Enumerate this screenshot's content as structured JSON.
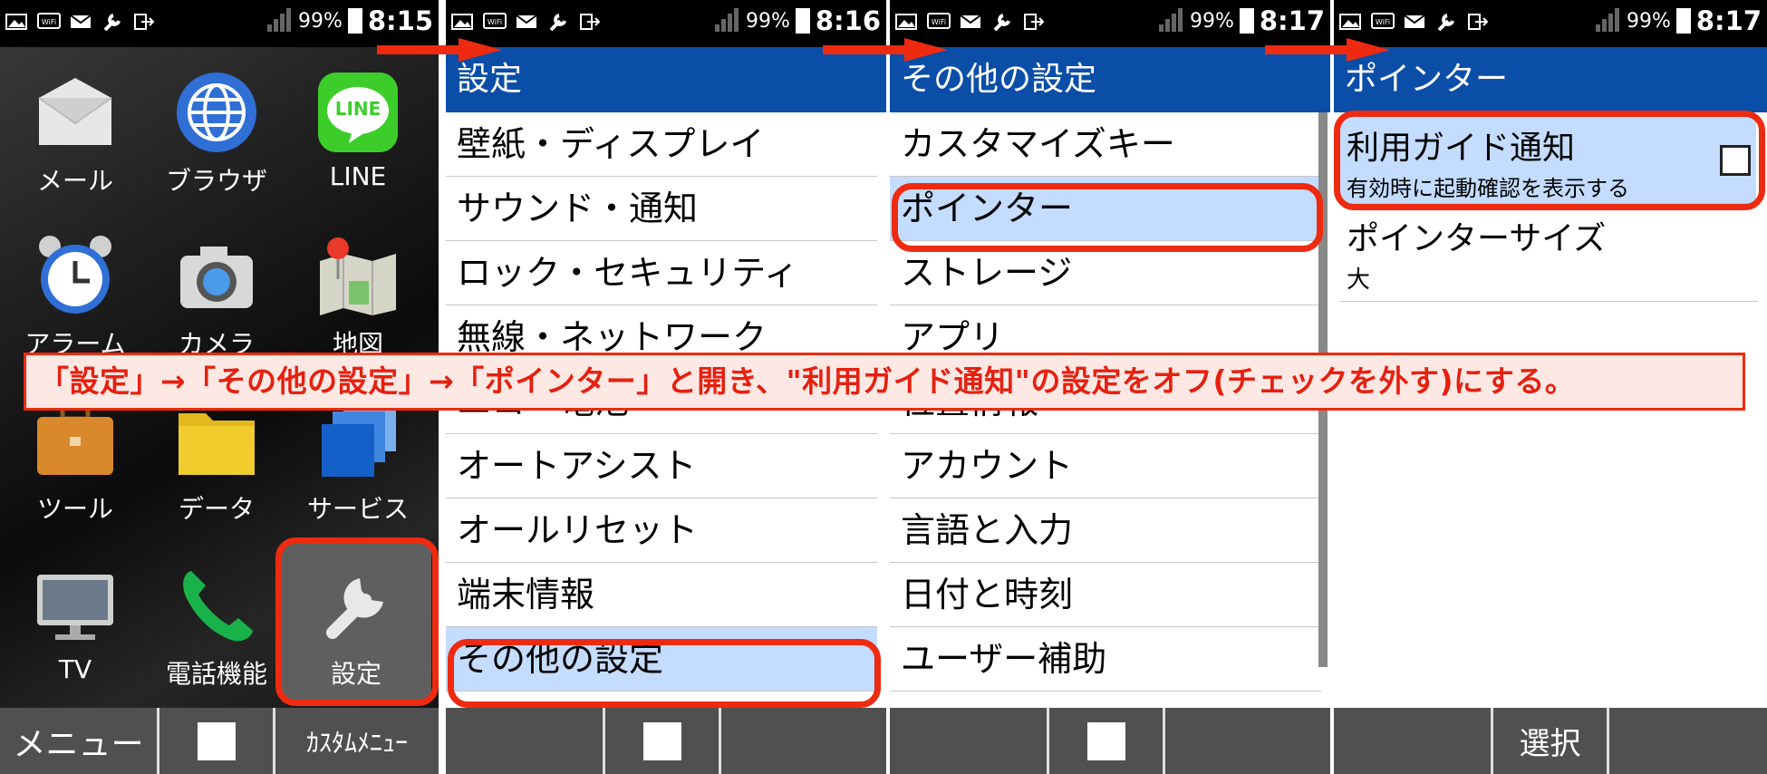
{
  "status": {
    "battery": "99%",
    "times": [
      "8:15",
      "8:16",
      "8:17",
      "8:17"
    ]
  },
  "home": {
    "apps": [
      {
        "label": "メール",
        "icon": "mail-envelope-icon"
      },
      {
        "label": "ブラウザ",
        "icon": "globe-browser-icon"
      },
      {
        "label": "LINE",
        "icon": "line-chat-icon",
        "icon_text": "LINE"
      },
      {
        "label": "アラーム",
        "icon": "alarm-clock-icon"
      },
      {
        "label": "カメラ",
        "icon": "camera-icon"
      },
      {
        "label": "地図",
        "icon": "map-pin-icon"
      },
      {
        "label": "ツール",
        "icon": "toolbox-icon"
      },
      {
        "label": "データ",
        "icon": "folder-icon"
      },
      {
        "label": "サービス",
        "icon": "stacked-cards-icon"
      },
      {
        "label": "TV",
        "icon": "tv-icon"
      },
      {
        "label": "電話機能",
        "icon": "phone-handset-icon"
      },
      {
        "label": "設定",
        "icon": "wrench-icon"
      }
    ],
    "softkeys": [
      "メニュー",
      "",
      "ｶｽﾀﾑﾒﾆｭｰ"
    ]
  },
  "settings": {
    "title": "設定",
    "items": [
      "壁紙・ディスプレイ",
      "サウンド・通知",
      "ロック・セキュリティ",
      "無線・ネットワーク",
      "エコ・電池",
      "オートアシスト",
      "オールリセット",
      "端末情報",
      "その他の設定"
    ]
  },
  "other": {
    "title": "その他の設定",
    "items": [
      "カスタマイズキー",
      "ポインター",
      "ストレージ",
      "アプリ",
      "位置情報",
      "アカウント",
      "言語と入力",
      "日付と時刻",
      "ユーザー補助"
    ]
  },
  "pointer": {
    "title": "ポインター",
    "guide_title": "利用ガイド通知",
    "guide_sub": "有効時に起動確認を表示する",
    "guide_checked": false,
    "size_title": "ポインターサイズ",
    "size_value": "大",
    "softkey": "選択"
  },
  "banner": "「設定」→「その他の設定」→「ポインター」と開き、\"利用ガイド通知\"の設定をオフ(チェックを外す)にする。",
  "colors": {
    "accent": "#ee2a10",
    "title_bar": "#0a4ea8",
    "selection": "#c4dcff"
  }
}
